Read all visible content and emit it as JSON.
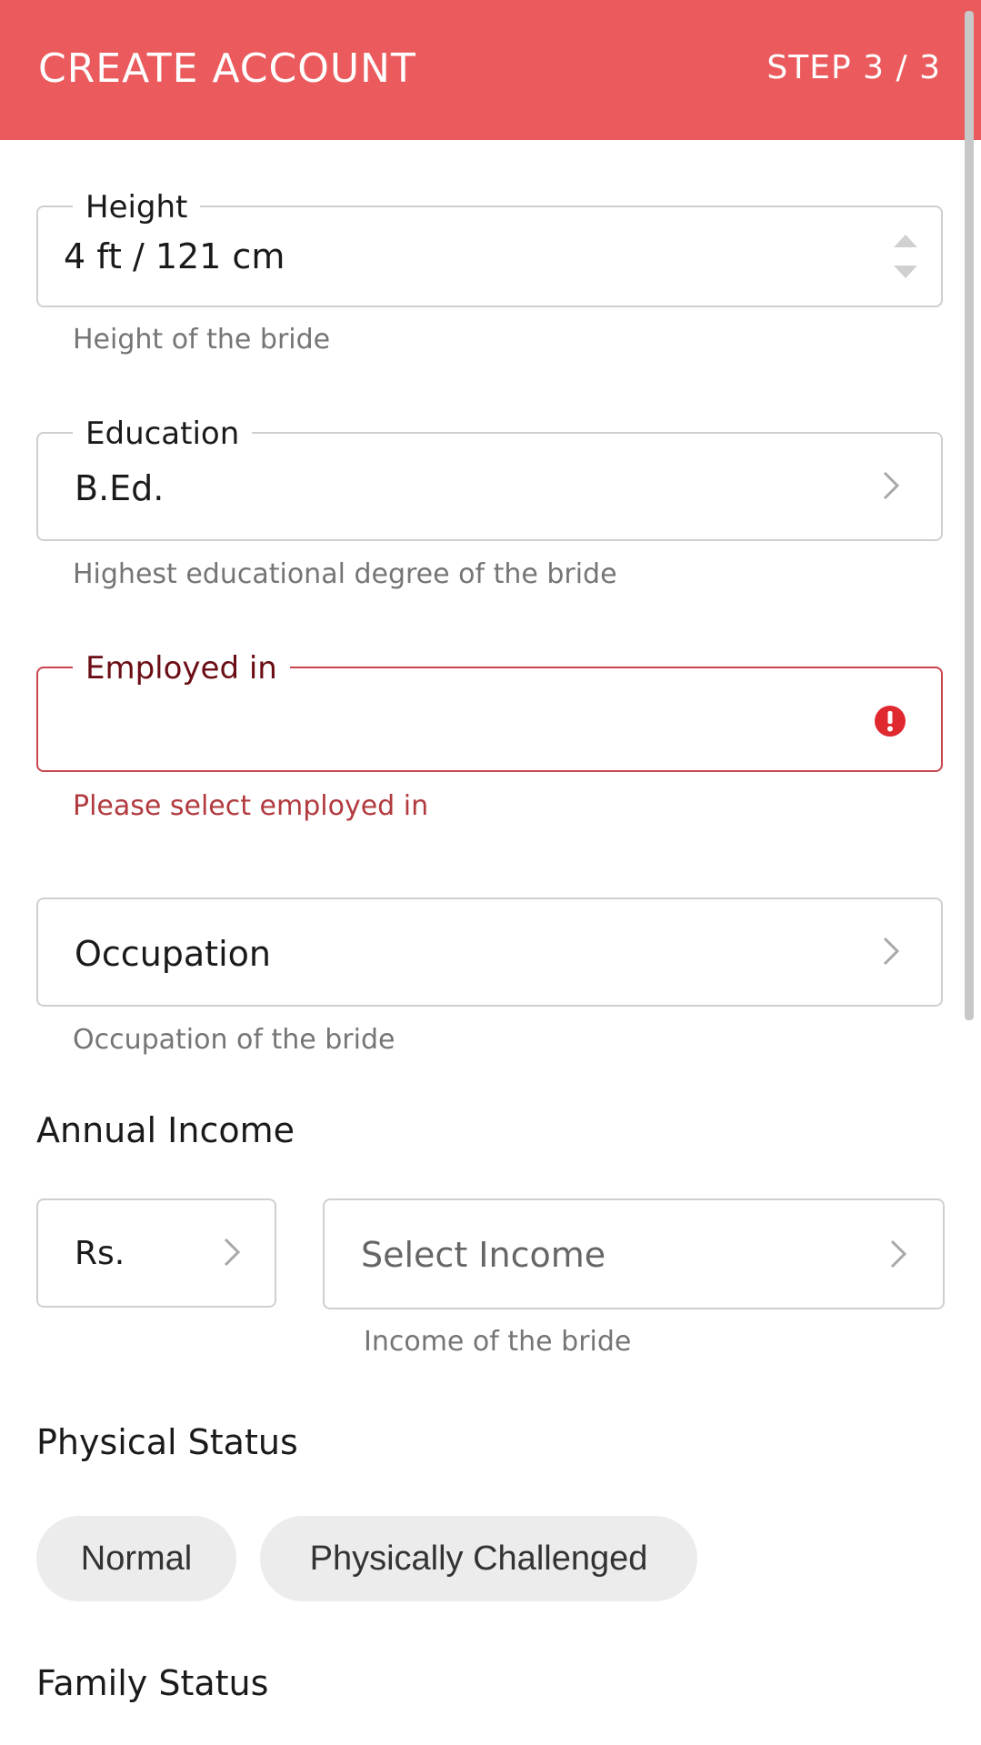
{
  "header": {
    "title": "CREATE ACCOUNT",
    "step": "STEP 3 / 3",
    "bg_color": "#eb5a5c"
  },
  "height_field": {
    "label": "Height",
    "value": "4 ft / 121 cm",
    "helper": "Height of the bride",
    "icon": "stepper-arrows-icon"
  },
  "education_field": {
    "label": "Education",
    "value": "B.Ed.",
    "helper": "Highest educational degree of the bride",
    "icon": "chevron-right-icon"
  },
  "employed_field": {
    "label": "Employed in",
    "value": "",
    "error": "Please select employed in",
    "icon": "error-icon",
    "error_color": "#c8464e"
  },
  "occupation_field": {
    "placeholder": "Occupation",
    "helper": "Occupation of the bride",
    "icon": "chevron-right-icon"
  },
  "annual_income": {
    "title": "Annual Income",
    "currency": "Rs.",
    "income_placeholder": "Select Income",
    "helper": "Income of the bride"
  },
  "physical_status": {
    "title": "Physical Status",
    "options": [
      "Normal",
      "Physically Challenged"
    ]
  },
  "family_status": {
    "title": "Family Status"
  }
}
